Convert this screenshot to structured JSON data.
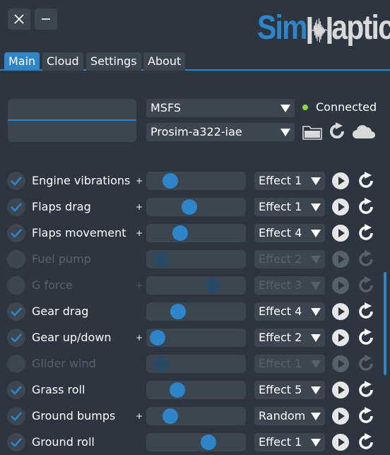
{
  "window": {
    "close_icon": "close-icon",
    "minimize_icon": "minimize-icon"
  },
  "logo": {
    "part1": "Sim",
    "part2": "aptic",
    "wave_letter": "H"
  },
  "tabs": [
    {
      "label": "Main",
      "active": true
    },
    {
      "label": "Cloud",
      "active": false
    },
    {
      "label": "Settings",
      "active": false
    },
    {
      "label": "About",
      "active": false
    }
  ],
  "sim": {
    "selected": "MSFS"
  },
  "profile": {
    "selected": "Prosim-a322-iae"
  },
  "status": {
    "text": "Connected",
    "color": "#8ad93a"
  },
  "colors": {
    "accent": "#2e86c9",
    "panel": "#3c4651",
    "background": "#2c3540",
    "disabled": "#57616c"
  },
  "effects": [
    {
      "label": "Engine vibrations",
      "checked": true,
      "enabled": true,
      "boost": true,
      "level": 0.18,
      "effect": "Effect 1"
    },
    {
      "label": "Flaps drag",
      "checked": true,
      "enabled": true,
      "boost": true,
      "level": 0.42,
      "effect": "Effect 1"
    },
    {
      "label": "Flaps movement",
      "checked": true,
      "enabled": true,
      "boost": true,
      "level": 0.3,
      "effect": "Effect 4"
    },
    {
      "label": "Fuel pump",
      "checked": false,
      "enabled": false,
      "boost": false,
      "level": 0.07,
      "effect": "Effect 2"
    },
    {
      "label": "G force",
      "checked": false,
      "enabled": false,
      "boost": true,
      "level": 0.7,
      "effect": "Effect 3"
    },
    {
      "label": "Gear drag",
      "checked": true,
      "enabled": true,
      "boost": false,
      "level": 0.28,
      "effect": "Effect 4"
    },
    {
      "label": "Gear up/down",
      "checked": true,
      "enabled": true,
      "boost": true,
      "level": 0.03,
      "effect": "Effect 2"
    },
    {
      "label": "Glider wind",
      "checked": false,
      "enabled": false,
      "boost": false,
      "level": 0.07,
      "effect": "Effect 1"
    },
    {
      "label": "Grass roll",
      "checked": true,
      "enabled": true,
      "boost": false,
      "level": 0.27,
      "effect": "Effect 5"
    },
    {
      "label": "Ground bumps",
      "checked": true,
      "enabled": true,
      "boost": true,
      "level": 0.18,
      "effect": "Random"
    },
    {
      "label": "Ground roll",
      "checked": true,
      "enabled": true,
      "boost": false,
      "level": 0.65,
      "effect": "Effect 1"
    }
  ],
  "boost_symbol": "+",
  "icons": {
    "check": "check-icon",
    "play": "play-icon",
    "reset": "reset-icon",
    "folder": "folder-icon",
    "refresh": "refresh-icon",
    "cloud": "cloud-icon"
  }
}
